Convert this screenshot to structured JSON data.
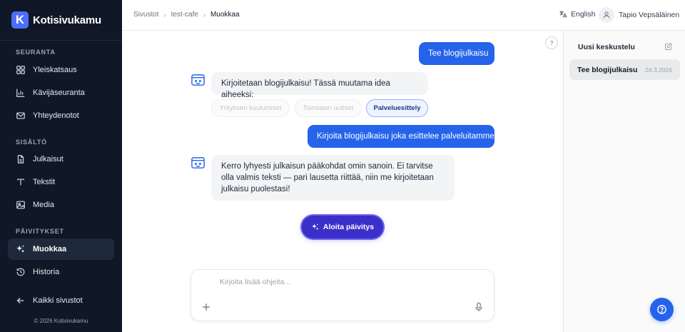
{
  "brand": {
    "logo_letter": "K",
    "name": "Kotisivukamu"
  },
  "sidebar": {
    "sections": [
      {
        "title": "SEURANTA"
      },
      {
        "title": "SISÄLTÖ"
      },
      {
        "title": "PÄIVITYKSET"
      }
    ],
    "items": [
      {
        "label": "Yleiskatsaus",
        "icon": "dashboard-icon"
      },
      {
        "label": "Kävijäseuranta",
        "icon": "bar-chart-icon"
      },
      {
        "label": "Yhteydenotot",
        "icon": "mail-icon"
      },
      {
        "label": "Julkaisut",
        "icon": "document-icon"
      },
      {
        "label": "Tekstit",
        "icon": "text-icon"
      },
      {
        "label": "Media",
        "icon": "image-icon"
      },
      {
        "label": "Muokkaa",
        "icon": "sparkles-icon",
        "active": true
      },
      {
        "label": "Historia",
        "icon": "history-icon"
      }
    ],
    "back_link": "Kaikki sivustot",
    "copyright": "© 2026 Kotisivukamu"
  },
  "header": {
    "breadcrumbs": [
      "Sivustot",
      "test-cafe",
      "Muokkaa"
    ],
    "language": "English",
    "user_name": "Tapio Vepsäläinen"
  },
  "chat": {
    "help_glyph": "?",
    "messages": [
      {
        "role": "user",
        "text": "Tee blogijulkaisu"
      },
      {
        "role": "assistant",
        "text": "Kirjoitetaan blogijulkaisu! Tässä muutama idea aiheeksi:"
      },
      {
        "role": "user",
        "text": "Kirjoita blogijulkaisu joka esittelee palveluitamme"
      },
      {
        "role": "assistant",
        "text": "Kerro lyhyesti julkaisun pääkohdat omin sanoin. Ei tarvitse olla valmis teksti — pari lausetta riittää, niin me kirjoitetaan julkaisu puolestasi!"
      }
    ],
    "suggestions": [
      {
        "label": "Yrityksen kuulumiset",
        "selected": false
      },
      {
        "label": "Toimialan uutiset",
        "selected": false
      },
      {
        "label": "Palveluesittely",
        "selected": true
      }
    ],
    "start_button": "Aloita päivitys",
    "composer": {
      "placeholder": "Kirjoita lisää ohjeita...",
      "value": ""
    }
  },
  "conversations": {
    "new_label": "Uusi keskustelu",
    "items": [
      {
        "title": "Tee blogijulkaisu",
        "date": "24.3.2026",
        "active": true
      }
    ]
  },
  "colors": {
    "sidebar_bg": "#101828",
    "accent": "#2563eb",
    "cta": "#3b2fc9"
  }
}
